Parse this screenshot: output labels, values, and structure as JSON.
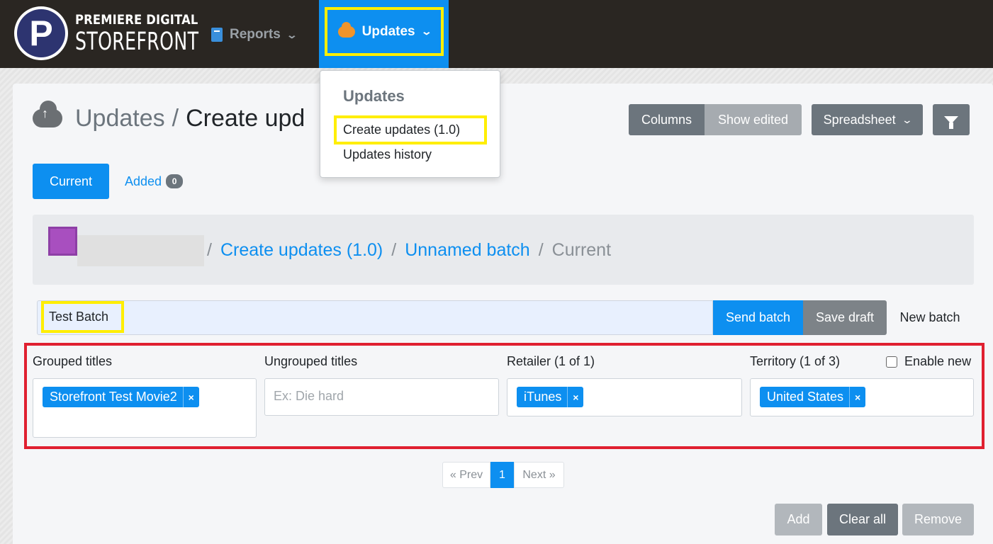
{
  "navbar": {
    "logo": {
      "letter": "P",
      "line1": "PREMIERE DIGITAL",
      "line2": "STOREFRONT"
    },
    "reports_label": "Reports",
    "updates_label": "Updates",
    "accent": "#0d8ff0",
    "highlight": "#ffee00"
  },
  "dropdown": {
    "header": "Updates",
    "items": [
      "Create updates (1.0)",
      "Updates history"
    ]
  },
  "page": {
    "title": "Updates",
    "subtitle": "Create upd",
    "toolbar": {
      "columns": "Columns",
      "show_edited": "Show edited",
      "spreadsheet": "Spreadsheet",
      "filter_icon": "filter-icon"
    }
  },
  "tabs": {
    "current": "Current",
    "added": "Added",
    "added_count": "0"
  },
  "breadcrumb": {
    "items": [
      "Create updates (1.0)",
      "Unnamed batch"
    ],
    "current": "Current"
  },
  "batch": {
    "name": "Test Batch",
    "send": "Send batch",
    "save": "Save draft",
    "new": "New batch"
  },
  "filters": {
    "grouped_label": "Grouped titles",
    "grouped_chips": [
      "Storefront Test Movie2"
    ],
    "ungrouped_label": "Ungrouped titles",
    "ungrouped_placeholder": "Ex: Die hard",
    "retailer_label": "Retailer (1 of 1)",
    "retailer_chips": [
      "iTunes"
    ],
    "territory_label": "Territory (1 of 3)",
    "territory_chips": [
      "United States"
    ],
    "enable_new": "Enable new",
    "chip_remove": "×"
  },
  "pagination": {
    "prev": "« Prev",
    "page": "1",
    "next": "Next »"
  },
  "actions": {
    "add": "Add",
    "clear": "Clear all",
    "remove": "Remove"
  }
}
